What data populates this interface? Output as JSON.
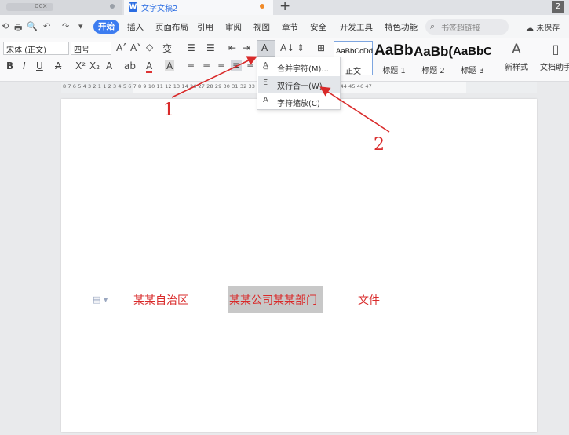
{
  "title_bar": {
    "tab1_label": "ocx",
    "tab2_label": "文字文稿2",
    "tab2_icon": "W",
    "new_tab": "+",
    "window_count": "2"
  },
  "quick_access": [
    "⟲",
    "🖶",
    "🔍",
    "↶",
    "↷",
    "▾"
  ],
  "menu": {
    "start": "开始",
    "items": [
      "插入",
      "页面布局",
      "引用",
      "审阅",
      "视图",
      "章节",
      "安全",
      "开发工具",
      "特色功能"
    ],
    "search_placeholder": "书签超链接",
    "unsaved": "未保存"
  },
  "ribbon": {
    "font_name": "宋体 (正文)",
    "font_size": "四号",
    "styles": [
      {
        "preview": "AaBbCcDd",
        "label": "正文"
      },
      {
        "preview": "AaBb",
        "label": "标题 1"
      },
      {
        "preview": "AaBb(",
        "label": "标题 2"
      },
      {
        "preview": "AaBbC",
        "label": "标题 3"
      }
    ],
    "new_style": "新样式",
    "doc_assistant": "文档助手"
  },
  "ruler_text": "8 7 6 5 4 3 2 1   1 2 3 4 5 6 7 8 9 10 11 12 13 14                          26 27 28 29 30 31 32 33 34 35 36 37 38 39 40 41 42 43 44 45 46 47",
  "dropdown": {
    "items": [
      {
        "icon": "A̲",
        "label": "合并字符(M)..."
      },
      {
        "icon": "Ξ",
        "label": "双行合一(W)..."
      },
      {
        "icon": "A",
        "label": "字符缩放(C)"
      }
    ]
  },
  "document": {
    "text1": "某某自治区",
    "text2": "某某公司某某部门",
    "text3": "文件"
  },
  "annotations": {
    "label1": "1",
    "label2": "2"
  },
  "colors": {
    "accent": "#3c7cf0",
    "annotation": "#d92a2a"
  }
}
